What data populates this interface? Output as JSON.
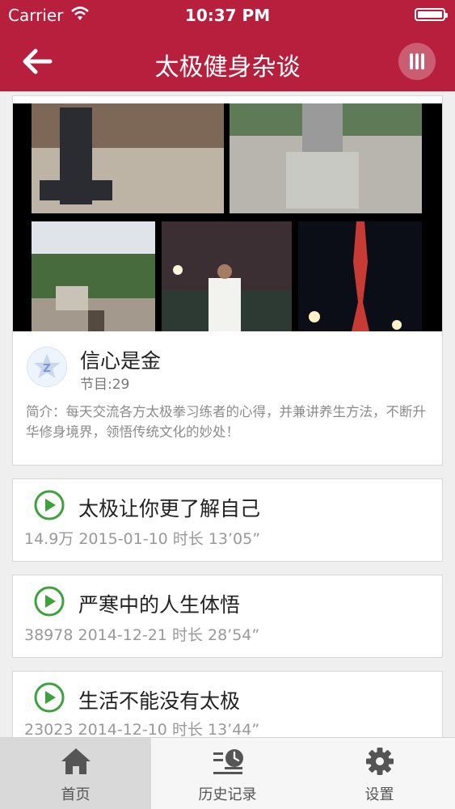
{
  "status_bar": {
    "carrier": "Carrier",
    "time": "10:37 PM"
  },
  "nav": {
    "title": "太极健身杂谈",
    "back_icon": "back-arrow-icon",
    "menu_icon": "bars-menu-icon"
  },
  "colors": {
    "brand": "#b71f3d",
    "play": "#3ca33c",
    "tab_active_bg": "#d9d9d9"
  },
  "album": {
    "title": "信心是金",
    "episode_count": "节目:29",
    "description": "简介：每天交流各方太极拳习练者的心得，并兼讲养生方法，不断升华修身境界，领悟传统文化的妙处！"
  },
  "episodes": [
    {
      "title": "太极让你更了解自己",
      "meta": "14.9万 2015-01-10  时长 13’05”"
    },
    {
      "title": "严寒中的人生体悟",
      "meta": "38978 2014-12-21  时长 28’54”"
    },
    {
      "title": "生活不能没有太极",
      "meta": "23023 2014-12-10  时长 13’44”"
    }
  ],
  "tabs": [
    {
      "label": "首页",
      "icon": "home-icon",
      "active": true
    },
    {
      "label": "历史记录",
      "icon": "history-icon",
      "active": false
    },
    {
      "label": "设置",
      "icon": "settings-gear-icon",
      "active": false
    }
  ]
}
